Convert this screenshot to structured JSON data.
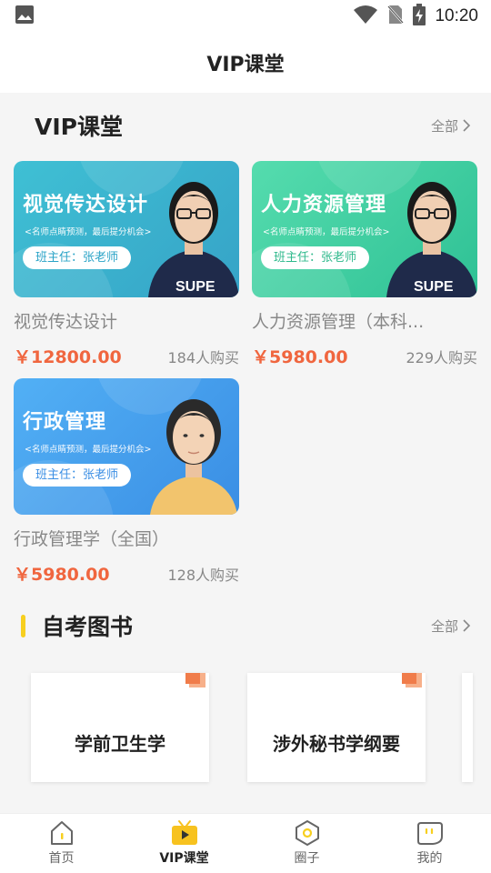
{
  "status_bar": {
    "time": "10:20"
  },
  "header": {
    "title": "VIP课堂"
  },
  "vip_section": {
    "title": "VIP课堂",
    "more_label": "全部"
  },
  "courses": [
    {
      "banner_title": "视觉传达设计",
      "banner_subtitle": "<名师点睛预测，最后提分机会>",
      "banner_tag": "班主任：张老师",
      "name": "视觉传达设计",
      "price": "￥12800.00",
      "buyers": "184人购买",
      "colors": [
        "#3fb6cf",
        "#34a0c4"
      ]
    },
    {
      "banner_title": "人力资源管理",
      "banner_subtitle": "<名师点睛预测，最后提分机会>",
      "banner_tag": "班主任：张老师",
      "name": "人力资源管理（本科...",
      "price": "￥5980.00",
      "buyers": "229人购买",
      "colors": [
        "#4cd6a7",
        "#2fbf94"
      ]
    },
    {
      "banner_title": "行政管理",
      "banner_subtitle": "<名师点睛预测，最后提分机会>",
      "banner_tag": "班主任：张老师",
      "name": "行政管理学（全国）",
      "price": "￥5980.00",
      "buyers": "128人购买",
      "colors": [
        "#4aa7f2",
        "#3a8fe4"
      ]
    }
  ],
  "books_section": {
    "title": "自考图书",
    "more_label": "全部"
  },
  "books": [
    {
      "name": "学前卫生学"
    },
    {
      "name": "涉外秘书学纲要"
    }
  ],
  "tabbar": {
    "tabs": [
      {
        "label": "首页",
        "icon": "home-icon",
        "active": false
      },
      {
        "label": "VIP课堂",
        "icon": "tv-icon",
        "active": true
      },
      {
        "label": "圈子",
        "icon": "hexagon-icon",
        "active": false
      },
      {
        "label": "我的",
        "icon": "profile-bubble-icon",
        "active": false
      }
    ]
  }
}
